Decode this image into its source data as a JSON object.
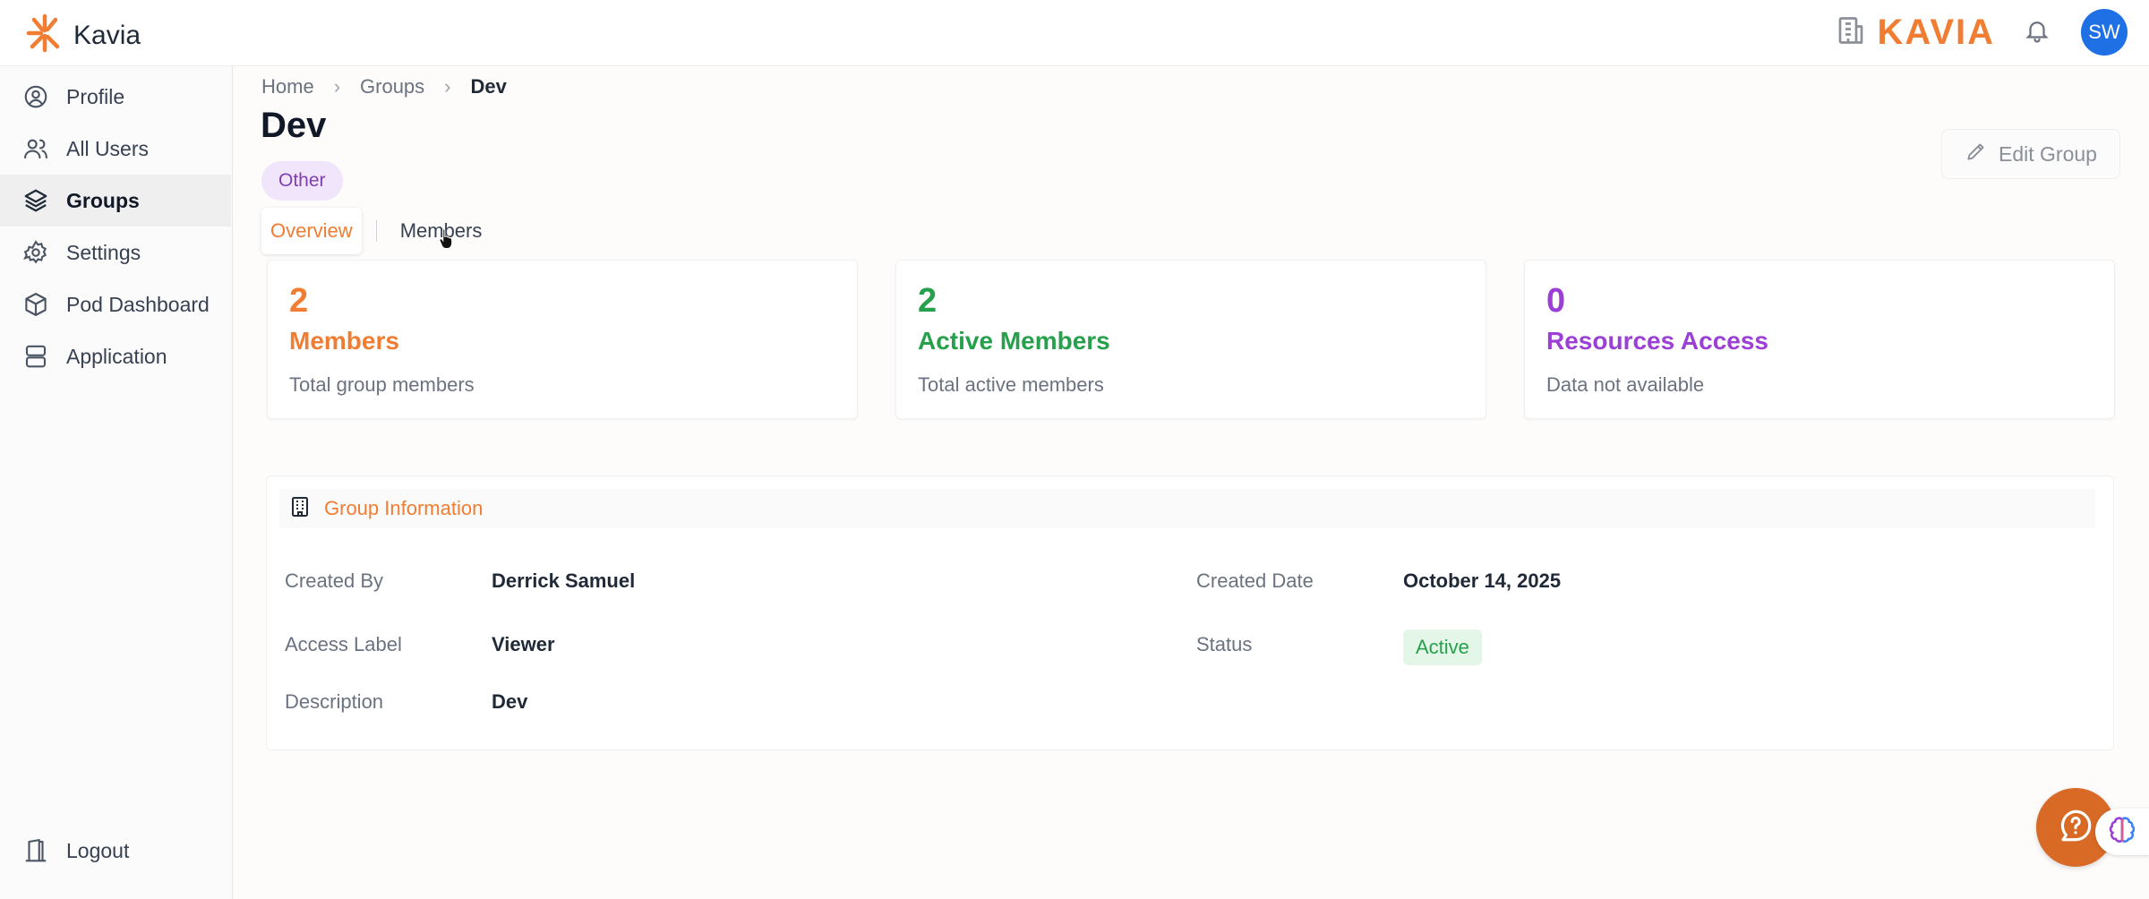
{
  "app": {
    "name": "Kavia",
    "logo_word": "KAVIA",
    "avatar_initials": "SW",
    "accent": "#f07d32"
  },
  "sidebar": {
    "items": [
      {
        "label": "Profile",
        "icon": "user-circle-icon"
      },
      {
        "label": "All Users",
        "icon": "users-icon"
      },
      {
        "label": "Groups",
        "icon": "layers-icon",
        "active": true
      },
      {
        "label": "Settings",
        "icon": "gear-icon"
      },
      {
        "label": "Pod Dashboard",
        "icon": "box-icon"
      },
      {
        "label": "Application",
        "icon": "server-icon"
      }
    ],
    "logout": "Logout"
  },
  "breadcrumb": {
    "home": "Home",
    "groups": "Groups",
    "current": "Dev"
  },
  "page": {
    "title": "Dev",
    "tag": "Other",
    "edit_label": "Edit Group"
  },
  "tabs": {
    "overview": "Overview",
    "members": "Members"
  },
  "stats": [
    {
      "value": "2",
      "title": "Members",
      "subtitle": "Total group members",
      "color": "#f07d32"
    },
    {
      "value": "2",
      "title": "Active Members",
      "subtitle": "Total active members",
      "color": "#27a04b"
    },
    {
      "value": "0",
      "title": "Resources Access",
      "subtitle": "Data not available",
      "color": "#9b3fd6"
    }
  ],
  "info": {
    "title": "Group Information",
    "created_by_label": "Created By",
    "created_by": "Derrick Samuel",
    "created_date_label": "Created Date",
    "created_date": "October 14, 2025",
    "access_label_label": "Access Label",
    "access_label": "Viewer",
    "status_label": "Status",
    "status": "Active",
    "description_label": "Description",
    "description": "Dev"
  }
}
